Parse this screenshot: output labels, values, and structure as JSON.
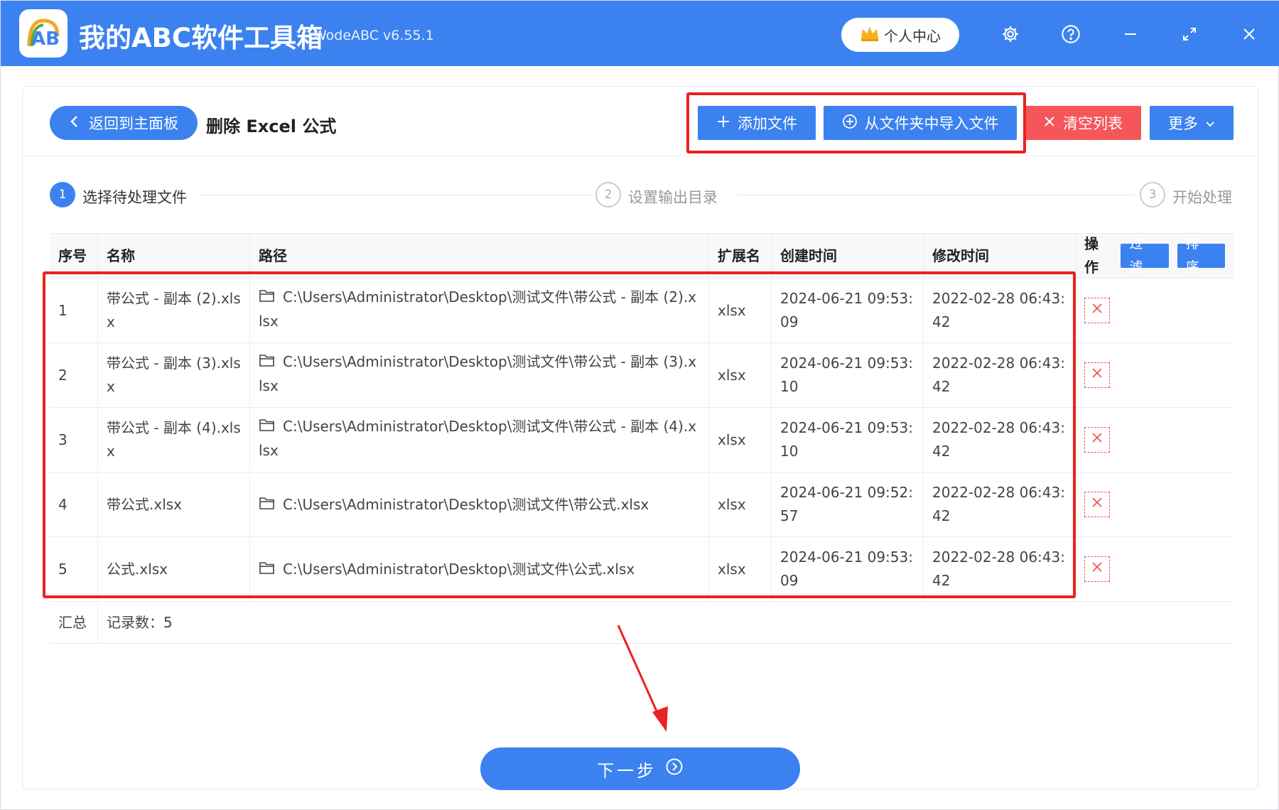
{
  "app": {
    "title": "我的ABC软件工具箱",
    "version": "WodeABC v6.55.1",
    "logo_text": "AB",
    "user_center": "个人中心"
  },
  "header": {
    "back_label": "返回到主面板",
    "page_title": "删除 Excel 公式",
    "add_file": "添加文件",
    "import_folder": "从文件夹中导入文件",
    "clear_list": "清空列表",
    "more": "更多"
  },
  "steps": [
    {
      "num": "1",
      "label": "选择待处理文件"
    },
    {
      "num": "2",
      "label": "设置输出目录"
    },
    {
      "num": "3",
      "label": "开始处理"
    }
  ],
  "table": {
    "columns": [
      "序号",
      "名称",
      "路径",
      "扩展名",
      "创建时间",
      "修改时间",
      "操作"
    ],
    "filter_label": "过 滤",
    "sort_label": "排 序",
    "rows": [
      {
        "idx": "1",
        "name": "带公式 - 副本 (2).xlsx",
        "path": "C:\\Users\\Administrator\\Desktop\\测试文件\\带公式 - 副本 (2).xlsx",
        "ext": "xlsx",
        "created": "2024-06-21 09:53:09",
        "modified": "2022-02-28 06:43:42"
      },
      {
        "idx": "2",
        "name": "带公式 - 副本 (3).xlsx",
        "path": "C:\\Users\\Administrator\\Desktop\\测试文件\\带公式 - 副本 (3).xlsx",
        "ext": "xlsx",
        "created": "2024-06-21 09:53:10",
        "modified": "2022-02-28 06:43:42"
      },
      {
        "idx": "3",
        "name": "带公式 - 副本 (4).xlsx",
        "path": "C:\\Users\\Administrator\\Desktop\\测试文件\\带公式 - 副本 (4).xlsx",
        "ext": "xlsx",
        "created": "2024-06-21 09:53:10",
        "modified": "2022-02-28 06:43:42"
      },
      {
        "idx": "4",
        "name": "带公式.xlsx",
        "path": "C:\\Users\\Administrator\\Desktop\\测试文件\\带公式.xlsx",
        "ext": "xlsx",
        "created": "2024-06-21 09:52:57",
        "modified": "2022-02-28 06:43:42"
      },
      {
        "idx": "5",
        "name": "公式.xlsx",
        "path": "C:\\Users\\Administrator\\Desktop\\测试文件\\公式.xlsx",
        "ext": "xlsx",
        "created": "2024-06-21 09:53:09",
        "modified": "2022-02-28 06:43:42"
      }
    ],
    "summary_label": "汇总",
    "summary_value": "记录数：5"
  },
  "footer": {
    "next_label": "下一步"
  },
  "colors": {
    "primary": "#3b82f0",
    "danger": "#f4565a",
    "annotation": "#ec2121"
  }
}
